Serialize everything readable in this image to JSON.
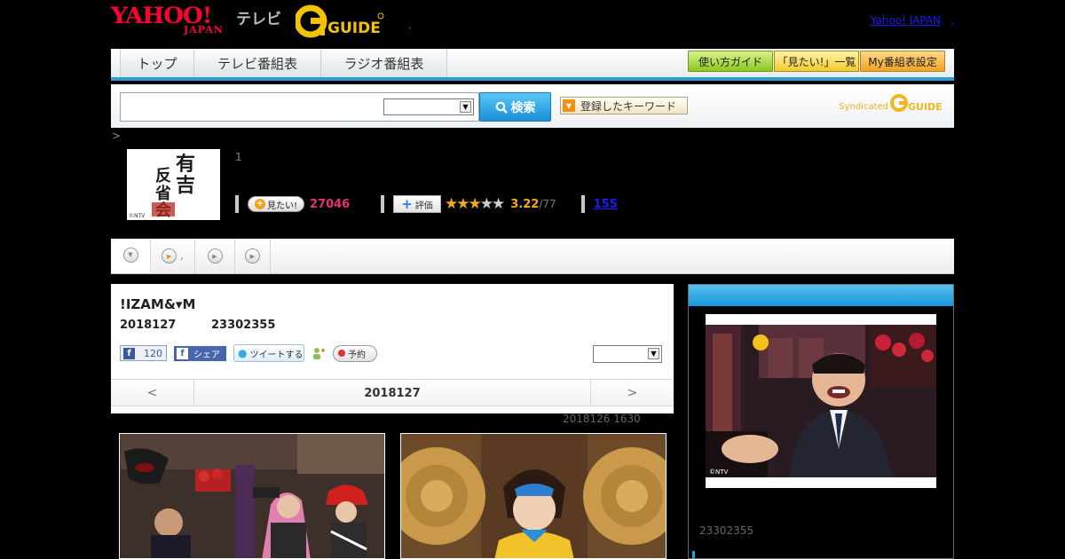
{
  "header": {
    "yahoo_logo": "YAHOO!",
    "japan_logo": "JAPAN",
    "tv_label": "テレビ",
    "gguide_logo": "GUIDE",
    "comma": ",",
    "yj_link": "Yahoo! JAPAN",
    "yj_link_suffix": ","
  },
  "nav": {
    "tabs": [
      {
        "label": "トップ"
      },
      {
        "label": "テレビ番組表"
      },
      {
        "label": "ラジオ番組表"
      }
    ],
    "buttons": [
      {
        "label": "使い方ガイド"
      },
      {
        "label": "「見たい!」一覧"
      },
      {
        "label": "My番組表設定"
      }
    ]
  },
  "search": {
    "placeholder": "",
    "button_label": "検索",
    "keyword_button": "登録したキーワード",
    "syndicated": "Syndicated",
    "syndicated_logo": "GUIDE"
  },
  "breadcrumb": ">",
  "program": {
    "image_title_chars": [
      "有",
      "吉",
      "反",
      "省",
      "会"
    ],
    "image_credit": "©NTV",
    "count": "1",
    "mitai_label": "見たい!",
    "mitai_count": "27046",
    "eval_label": "評価",
    "stars_filled": 3,
    "stars_total": 5,
    "rating": "3.22",
    "rating_suffix": "/77",
    "reviews": "155"
  },
  "tabrow": {
    "second_label": ","
  },
  "episode": {
    "title": "!IZAM&▾M",
    "date": "2018127",
    "time": "23302355",
    "fb_like_count": "120",
    "fb_share": "シェア",
    "tweet": "ツイートする",
    "reserve": "予約",
    "nav_prev": "<",
    "nav_date": "2018127",
    "nav_next": ">",
    "updated": "2018126  1630"
  },
  "sidebar": {
    "image_credit": "©NTV",
    "time": "23302355"
  },
  "colors": {
    "accent_blue": "#2a9fd8",
    "mitai_pink": "#e6317a",
    "star_orange": "#f3a91c",
    "link_blue": "#1a1aff"
  }
}
